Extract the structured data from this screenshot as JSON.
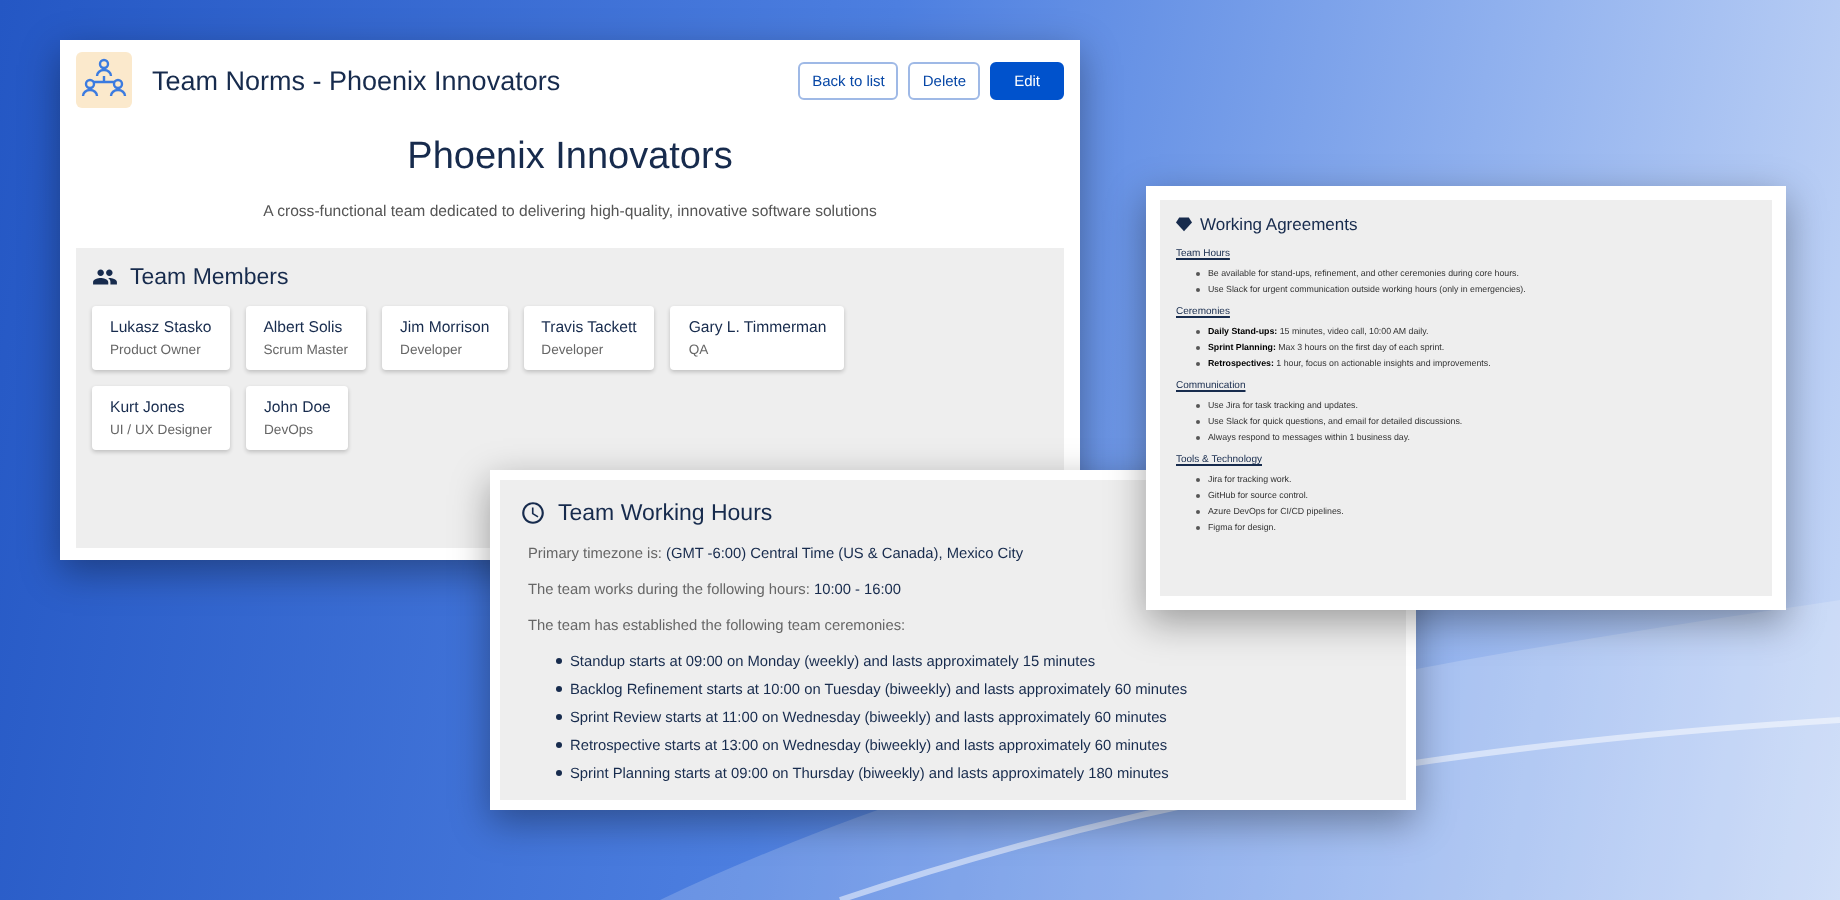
{
  "main_card": {
    "title": "Team Norms - Phoenix Innovators",
    "buttons": [
      {
        "label": "Back to list",
        "kind": "outline"
      },
      {
        "label": "Delete",
        "kind": "outline"
      },
      {
        "label": "Edit",
        "kind": "primary"
      }
    ],
    "team_name": "Phoenix Innovators",
    "description": "A cross-functional team dedicated to delivering high-quality, innovative software solutions",
    "members_section": {
      "title": "Team Members",
      "members": [
        {
          "name": "Lukasz Stasko",
          "role": "Product Owner"
        },
        {
          "name": "Albert Solis",
          "role": "Scrum Master"
        },
        {
          "name": "Jim Morrison",
          "role": "Developer"
        },
        {
          "name": "Travis Tackett",
          "role": "Developer"
        },
        {
          "name": "Gary L. Timmerman",
          "role": "QA"
        },
        {
          "name": "Kurt Jones",
          "role": "UI / UX Designer"
        },
        {
          "name": "John Doe",
          "role": "DevOps"
        }
      ]
    }
  },
  "working_hours": {
    "title": "Team Working Hours",
    "lines": [
      "Primary timezone is: **(GMT -6:00) Central Time (US & Canada), Mexico City**",
      "The team works during the following hours: **10:00 - 16:00**",
      "The team has established the following team ceremonies:"
    ],
    "ceremonies": [
      "Standup starts at 09:00 on Monday (weekly) and lasts approximately 15 minutes",
      "Backlog Refinement starts at 10:00 on Tuesday (biweekly) and lasts approximately 60 minutes",
      "Sprint Review starts at 11:00 on Wednesday (biweekly) and lasts approximately 60 minutes",
      "Retrospective starts at 13:00 on Wednesday (biweekly) and lasts approximately 60 minutes",
      "Sprint Planning starts at 09:00 on Thursday (biweekly) and lasts approximately 180 minutes"
    ]
  },
  "working_agreements": {
    "title": "Working Agreements",
    "sections": [
      {
        "heading": "Team Hours",
        "items": [
          "Be available for stand-ups, refinement, and other ceremonies during core hours.",
          "Use Slack for urgent communication outside working hours (only in emergencies)."
        ]
      },
      {
        "heading": "Ceremonies",
        "items": [
          "**Daily Stand-ups:** 15 minutes, video call, 10:00 AM daily.",
          "**Sprint Planning:** Max 3 hours on the first day of each sprint.",
          "**Retrospectives:** 1 hour, focus on actionable insights and improvements."
        ]
      },
      {
        "heading": "Communication",
        "items": [
          "Use Jira for task tracking and updates.",
          "Use Slack for quick questions, and email for detailed discussions.",
          "Always respond to messages within 1 business day."
        ]
      },
      {
        "heading": "Tools & Technology",
        "items": [
          "Jira for tracking work.",
          "GitHub for source control.",
          "Azure DevOps for CI/CD pipelines.",
          "Figma for design."
        ]
      }
    ]
  }
}
